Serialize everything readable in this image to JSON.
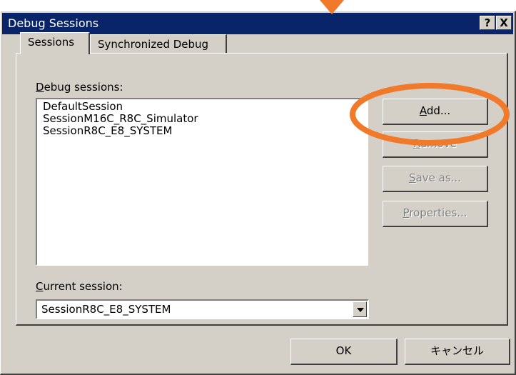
{
  "window": {
    "title": "Debug Sessions",
    "help_label": "?",
    "close_label": "X"
  },
  "tabs": [
    {
      "label": "Sessions",
      "active": true
    },
    {
      "label": "Synchronized Debug",
      "active": false
    }
  ],
  "sessions_list": {
    "label_mnemonic": "D",
    "label_rest": "ebug sessions:",
    "items": [
      "DefaultSession",
      "SessionM16C_R8C_Simulator",
      "SessionR8C_E8_SYSTEM"
    ]
  },
  "buttons": {
    "add": {
      "mnemonic": "A",
      "rest": "dd..."
    },
    "remove": {
      "mnemonic": "R",
      "rest": "emove"
    },
    "save_as": {
      "mnemonic": "S",
      "rest": "ave as..."
    },
    "properties": {
      "mnemonic": "P",
      "rest": "roperties..."
    },
    "ok": "OK",
    "cancel": "キャンセル"
  },
  "current_session": {
    "label_mnemonic": "C",
    "label_rest": "urrent session:",
    "value": "SessionR8C_E8_SYSTEM"
  },
  "colors": {
    "annotation_orange": "#f07a2a",
    "titlebar": "#0a246a",
    "dialog_face": "#d4d0c8"
  },
  "icons": {
    "annotation_arrow": "arrow-down-icon",
    "annotation_circle": "highlight-ellipse-icon",
    "combo_arrow": "chevron-down-icon"
  }
}
